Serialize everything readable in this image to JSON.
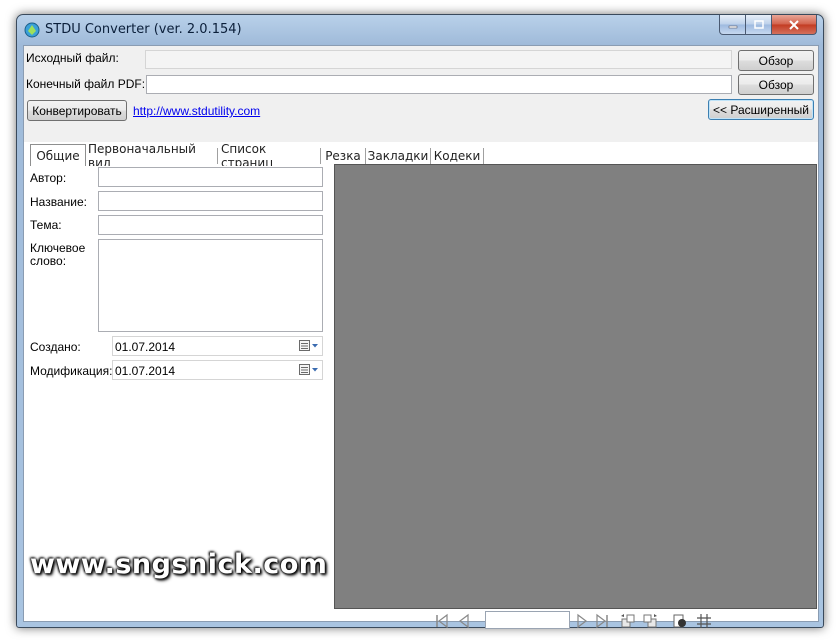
{
  "window": {
    "title": "STDU Converter (ver. 2.0.154)"
  },
  "top": {
    "source_label": "Исходный файл:",
    "source_value": "",
    "dest_label": "Конечный файл PDF:",
    "dest_value": "",
    "browse_label": "Обзор",
    "convert_label": "Конвертировать",
    "link_text": "http://www.stdutility.com ",
    "advanced_label": "<< Расширенный"
  },
  "tabs": [
    {
      "label": "Общие",
      "active": true
    },
    {
      "label": "Первоначальный вид"
    },
    {
      "label": "Список страниц"
    },
    {
      "label": "Резка"
    },
    {
      "label": "Закладки"
    },
    {
      "label": "Кодеки"
    }
  ],
  "general": {
    "author_label": "Автор:",
    "author_value": "",
    "title_label": "Название:",
    "title_value": "",
    "subject_label": "Тема:",
    "subject_value": "",
    "keywords_label_line1": "Ключевое",
    "keywords_label_line2": "слово:",
    "keywords_value": "",
    "created_label": "Создано:",
    "created_value": "01.07.2014",
    "modified_label": "Модификация:",
    "modified_value": "01.07.2014"
  },
  "navigation": {
    "page_value": ""
  },
  "watermark": "www.sngsnick.com",
  "icons": {
    "app": "stdu-app-icon",
    "calendar": "calendar-icon",
    "first": "first-page-icon",
    "prev": "prev-page-icon",
    "next": "next-page-icon",
    "last": "last-page-icon",
    "rotate_left": "rotate-left-icon",
    "rotate_right": "rotate-right-icon",
    "view": "view-mode-icon",
    "grid": "grid-icon"
  },
  "colors": {
    "preview_bg": "#808080",
    "link": "#0000ee",
    "title_bar": "#a9c4e1"
  }
}
